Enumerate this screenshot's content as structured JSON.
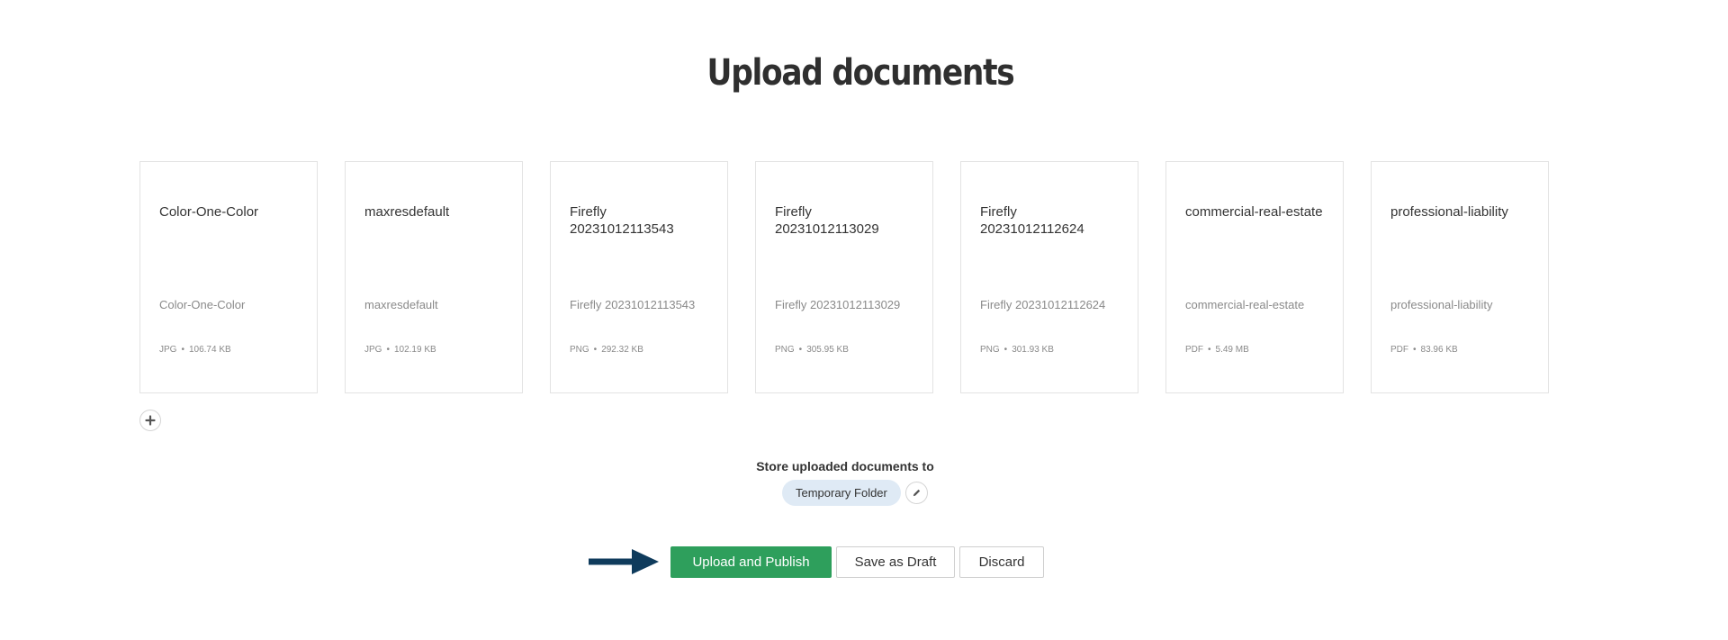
{
  "page": {
    "title": "Upload documents"
  },
  "documents": [
    {
      "title": "Color-One-Color",
      "description": "Color-One-Color",
      "type": "JPG",
      "size": "106.74 KB"
    },
    {
      "title": "maxresdefault",
      "description": "maxresdefault",
      "type": "JPG",
      "size": "102.19 KB"
    },
    {
      "title": "Firefly 20231012113543",
      "description": "Firefly 20231012113543",
      "type": "PNG",
      "size": "292.32 KB"
    },
    {
      "title": "Firefly 20231012113029",
      "description": "Firefly 20231012113029",
      "type": "PNG",
      "size": "305.95 KB"
    },
    {
      "title": "Firefly 20231012112624",
      "description": "Firefly 20231012112624",
      "type": "PNG",
      "size": "301.93 KB"
    },
    {
      "title": "commercial-real-estate",
      "description": "commercial-real-estate",
      "type": "PDF",
      "size": "5.49 MB"
    },
    {
      "title": "professional-liability",
      "description": "professional-liability",
      "type": "PDF",
      "size": "83.96 KB"
    }
  ],
  "meta_separator": "•",
  "add_button": {
    "icon": "plus-icon"
  },
  "storage": {
    "label": "Store uploaded documents to",
    "folder": "Temporary Folder",
    "edit_icon": "pencil-icon"
  },
  "actions": {
    "publish_label": "Upload and Publish",
    "draft_label": "Save as Draft",
    "discard_label": "Discard"
  },
  "colors": {
    "primary": "#2e9f5c",
    "folder_chip": "#dfeaf5",
    "arrow": "#0f3b5c"
  }
}
